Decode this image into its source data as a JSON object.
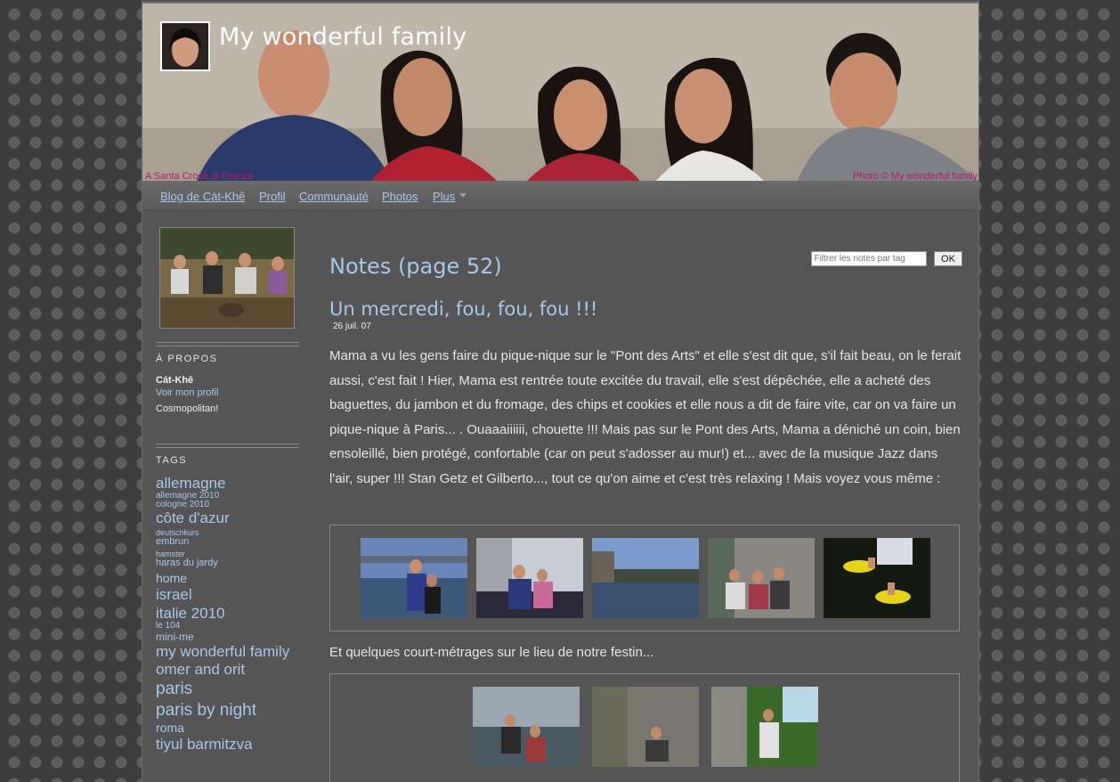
{
  "banner": {
    "site_title": "My wonderful family",
    "caption_left": "A Santa Croce di Firenze",
    "caption_right": "Photo © My wonderful family"
  },
  "nav": {
    "items": [
      {
        "label": "Blog de Cát-Khê"
      },
      {
        "label": "Profil"
      },
      {
        "label": "Communauté"
      },
      {
        "label": "Photos"
      },
      {
        "label": "Plus"
      }
    ]
  },
  "sidebar": {
    "about_heading": "À PROPOS",
    "author_name": "Cát-Khê",
    "profile_link": "Voir mon profil",
    "about_text": "Cosmopolitan!",
    "tags_heading": "TAGS",
    "tags": [
      {
        "label": "allemagne"
      },
      {
        "label": "allemagne 2010"
      },
      {
        "label": "cologne 2010"
      },
      {
        "label": "côte d'azur"
      },
      {
        "label": "deutschkurs"
      },
      {
        "label": "embrun"
      },
      {
        "label": "hamster"
      },
      {
        "label": "haras du jardy"
      },
      {
        "label": "home"
      },
      {
        "label": "israel"
      },
      {
        "label": "italie 2010"
      },
      {
        "label": "le 104"
      },
      {
        "label": "mini-me"
      },
      {
        "label": "my wonderful family"
      },
      {
        "label": "omer and orit"
      },
      {
        "label": "paris"
      },
      {
        "label": "paris by night"
      },
      {
        "label": "roma"
      },
      {
        "label": "tiyul barmitzva"
      }
    ]
  },
  "main": {
    "page_heading": "Notes (page 52)",
    "filter_placeholder": "Filtrer les notes par tag",
    "filter_button": "OK",
    "post": {
      "title": "Un mercredi, fou, fou, fou !!!",
      "date": "26 juil. 07",
      "body": "Mama a vu les gens faire du pique-nique sur le \"Pont des Arts\" et elle s'est dit que, s'il fait beau, on le ferait aussi, c'est fait ! Hier, Mama est rentrée toute excitée du travail, elle s'est dépêchée, elle a acheté des baguettes, du jambon et du fromage, des chips et cookies et elle nous a dit de faire vite, car on va faire un pique-nique à Paris... . Ouaaaiiiiii, chouette !!! Mais pas sur le Pont des Arts, Mama a déniché un coin, bien ensoleillé, bien protégé, confortable (car on peut s'adosser au mur!) et... avec de la musique Jazz dans l'air, super !!! Stan Getz et Gilberto..., tout ce qu'on aime et c'est très relaxing ! Mais voyez vous même :",
      "body_2": "Et quelques court-métrages sur le lieu de notre festin..."
    }
  },
  "colors": {
    "link": "#a8c8e8",
    "caption": "#c0166a",
    "page_bg": "#555555"
  }
}
